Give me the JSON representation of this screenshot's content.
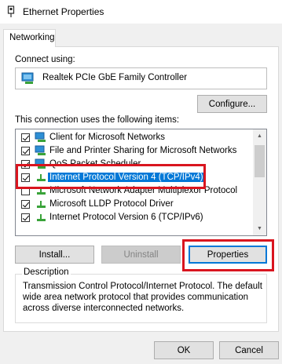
{
  "window": {
    "title": "Ethernet Properties"
  },
  "tabs": [
    {
      "label": "Networking"
    }
  ],
  "connect_using": {
    "label": "Connect using:",
    "adapter": "Realtek PCIe GbE Family Controller",
    "configure_button": "Configure..."
  },
  "items_section": {
    "label": "This connection uses the following items:",
    "items": [
      {
        "label": "Client for Microsoft Networks",
        "checked": true,
        "icon": "client-network-icon"
      },
      {
        "label": "File and Printer Sharing for Microsoft Networks",
        "checked": true,
        "icon": "file-printer-sharing-icon"
      },
      {
        "label": "QoS Packet Scheduler",
        "checked": true,
        "icon": "qos-scheduler-icon"
      },
      {
        "label": "Internet Protocol Version 4 (TCP/IPv4)",
        "checked": true,
        "selected": true,
        "icon": "protocol-icon"
      },
      {
        "label": "Microsoft Network Adapter Multiplexor Protocol",
        "checked": false,
        "icon": "protocol-icon"
      },
      {
        "label": "Microsoft LLDP Protocol Driver",
        "checked": true,
        "icon": "protocol-icon"
      },
      {
        "label": "Internet Protocol Version 6 (TCP/IPv6)",
        "checked": true,
        "icon": "protocol-icon"
      }
    ]
  },
  "buttons": {
    "install": "Install...",
    "uninstall": "Uninstall",
    "properties": "Properties"
  },
  "description": {
    "legend": "Description",
    "text": "Transmission Control Protocol/Internet Protocol. The default wide area network protocol that provides communication across diverse interconnected networks."
  },
  "footer": {
    "ok": "OK",
    "cancel": "Cancel"
  },
  "colors": {
    "selection": "#0078d7",
    "highlight_box": "#d9151f"
  }
}
